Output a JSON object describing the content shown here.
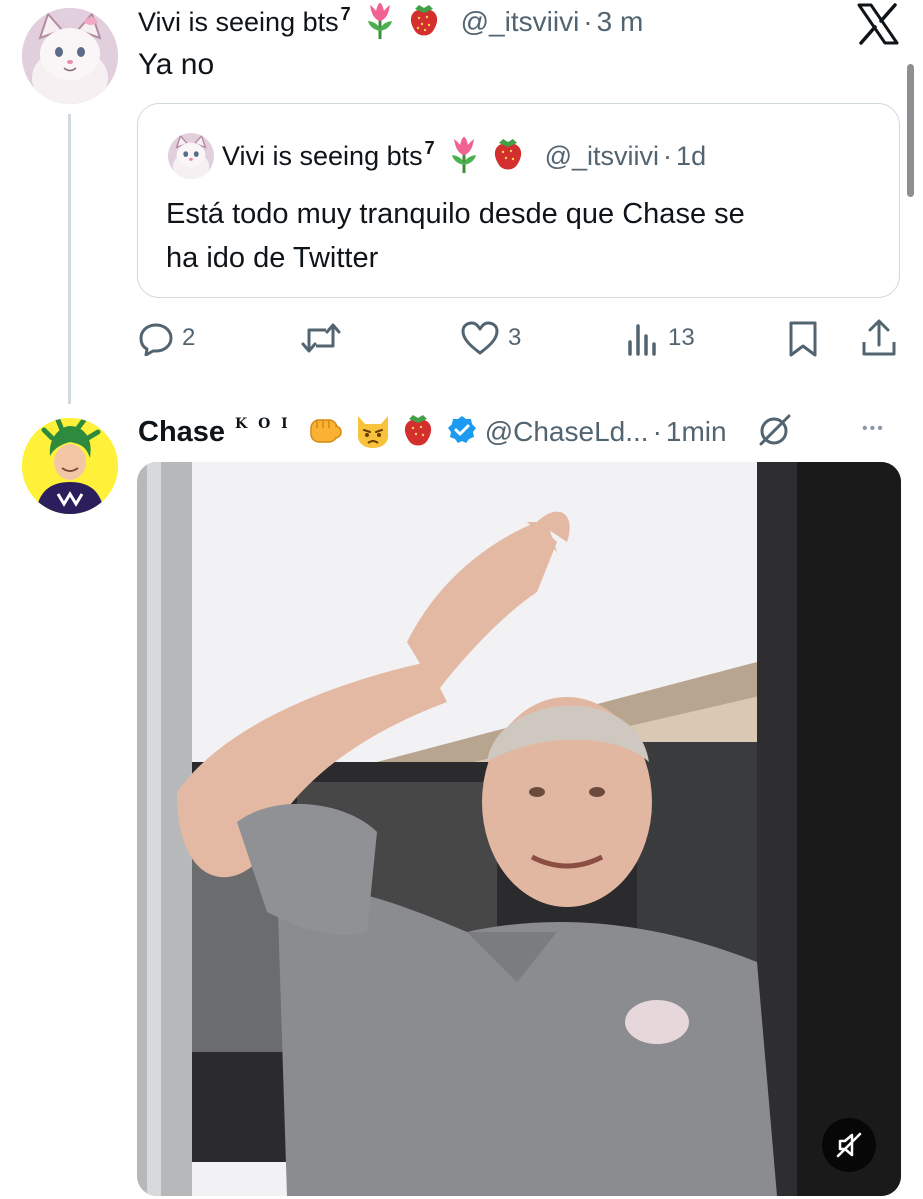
{
  "reply": {
    "display_name": "Vivi is seeing bts",
    "name_superscript": "7",
    "handle": "@_itsviivi",
    "separator": "·",
    "time": "3 m",
    "text": "Ya no",
    "quoted": {
      "display_name": "Vivi is seeing bts",
      "name_superscript": "7",
      "handle": "@_itsviivi",
      "separator": "·",
      "time": "1d",
      "text_line1": "Está todo muy tranquilo desde que Chase se",
      "text_line2": "ha ido de Twitter"
    },
    "actions": {
      "replies": "2",
      "likes": "3",
      "views": "13"
    }
  },
  "tweet": {
    "display_name": "Chase",
    "name_tag": "K O I",
    "handle": "@ChaseLd...",
    "separator": "·",
    "time": "1min",
    "more": "•••"
  },
  "icons": {
    "close": "x-logo-icon",
    "reply": "reply-icon",
    "retweet": "retweet-icon",
    "like": "heart-icon",
    "views": "views-icon",
    "bookmark": "bookmark-icon",
    "share": "share-icon",
    "verified": "verified-badge-icon",
    "mute": "mute-icon"
  },
  "colors": {
    "text": "#0f1419",
    "muted": "#536471",
    "verified": "#1d9bf0",
    "border": "#cfd9de"
  }
}
